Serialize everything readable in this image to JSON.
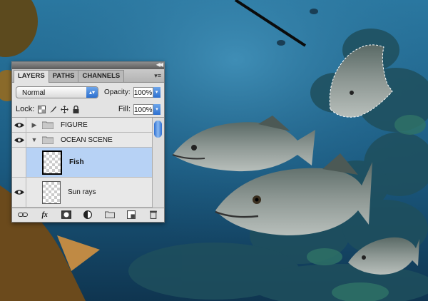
{
  "panel": {
    "tabs": [
      {
        "label": "LAYERS"
      },
      {
        "label": "PATHS"
      },
      {
        "label": "CHANNELS"
      }
    ],
    "blend_mode": "Normal",
    "opacity_label": "Opacity:",
    "opacity_value": "100%",
    "lock_label": "Lock:",
    "fill_label": "Fill:",
    "fill_value": "100%",
    "layers": [
      {
        "name": "FIGURE",
        "type": "group",
        "expanded": false
      },
      {
        "name": "OCEAN SCENE",
        "type": "group",
        "expanded": true
      },
      {
        "name": "Fish",
        "type": "layer",
        "selected": true
      },
      {
        "name": "Sun rays",
        "type": "layer",
        "selected": false
      }
    ],
    "bottom_icons": [
      "link-icon",
      "fx-icon",
      "mask-icon",
      "adjustment-icon",
      "new-group-icon",
      "new-layer-icon",
      "trash-icon"
    ],
    "fx_label": "fx"
  },
  "colors": {
    "ocean": "#1d5f86",
    "selection": "#b7d2f5",
    "accent": "#2c6fd0"
  }
}
